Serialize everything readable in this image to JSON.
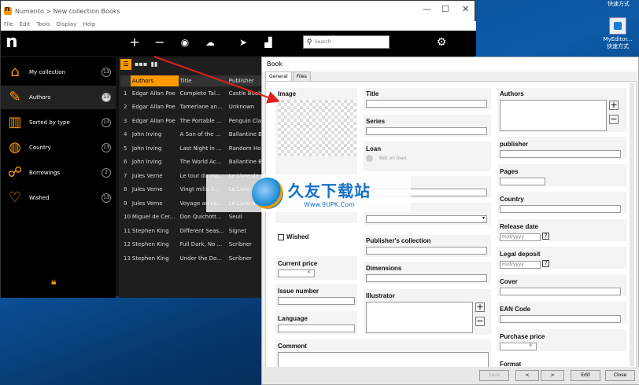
{
  "window": {
    "title": "Numento > New collection Books",
    "controls": [
      "—",
      "☐",
      "✕"
    ]
  },
  "menu": [
    "File",
    "Edit",
    "Tools",
    "Display",
    "Help"
  ],
  "desktop": {
    "top_label": "快速方式",
    "icon_label_1": "MyEditor...",
    "icon_label_2": "快速方式"
  },
  "toolbar": {
    "search_placeholder": "Search"
  },
  "sidebar": {
    "items": [
      {
        "label": "My collection",
        "count": "13"
      },
      {
        "label": "Authors",
        "count": "13"
      },
      {
        "label": "Sorted by type",
        "count": "13"
      },
      {
        "label": "Country",
        "count": "13"
      },
      {
        "label": "Borrowings",
        "count": "2"
      },
      {
        "label": "Wished",
        "count": "13"
      }
    ]
  },
  "grid": {
    "headers": [
      "Authors",
      "Title",
      "Publisher"
    ],
    "rows": [
      {
        "n": "1",
        "author": "Edgar Allan Poe",
        "title": "Complete Tal...",
        "publisher": "Castle Books"
      },
      {
        "n": "2",
        "author": "Edgar Allan Poe",
        "title": "Tamerlane an...",
        "publisher": "Unknown"
      },
      {
        "n": "3",
        "author": "Edgar Allan Poe",
        "title": "The Portable ...",
        "publisher": "Penguin Class"
      },
      {
        "n": "4",
        "author": "John Irving",
        "title": "A Son of the ...",
        "publisher": "Ballantine Bo"
      },
      {
        "n": "5",
        "author": "John Irving",
        "title": "Last Night in ...",
        "publisher": "Random Hous"
      },
      {
        "n": "6",
        "author": "John Irving",
        "title": "The World Ac...",
        "publisher": "Ballantine Bo"
      },
      {
        "n": "7",
        "author": "Jules Verne",
        "title": "Le tour du mo...",
        "publisher": "Le Livre de"
      },
      {
        "n": "8",
        "author": "Jules Verne",
        "title": "Vingt mille li...",
        "publisher": "Le Livre de"
      },
      {
        "n": "9",
        "author": "Jules Verne",
        "title": "Voyage au ce...",
        "publisher": "Le Livre de"
      },
      {
        "n": "10",
        "author": "Miguel de Cer...",
        "title": "Don Quichott...",
        "publisher": "Seuil"
      },
      {
        "n": "11",
        "author": "Stephen King",
        "title": "Different Seas...",
        "publisher": "Signet"
      },
      {
        "n": "12",
        "author": "Stephen King",
        "title": "Full Dark, No ...",
        "publisher": "Scribner"
      },
      {
        "n": "13",
        "author": "Stephen King",
        "title": "Under the Do...",
        "publisher": "Scribner"
      }
    ]
  },
  "watermark": {
    "main": "久友下载站",
    "url": "Www.9UPK.Com"
  },
  "dialog": {
    "title": "Book",
    "tabs": [
      "General",
      "Files"
    ],
    "image_label": "Image",
    "wished_label": "Wished",
    "current_price_label": "Current price",
    "currency": "€",
    "issue_number_label": "Issue number",
    "language_label": "Language",
    "comment_label": "Comment",
    "title_label": "Title",
    "series_label": "Series",
    "loan_label": "Loan",
    "loan_text": "Not on loan",
    "publishers_collection_label": "Publisher's collection",
    "dimensions_label": "Dimensions",
    "illustrator_label": "Illustrator",
    "authors_label": "Authors",
    "publisher_label": "publisher",
    "pages_label": "Pages",
    "country_label": "Country",
    "release_date_label": "Release date",
    "date_placeholder": "m/d/yyyy",
    "legal_deposit_label": "Legal deposit",
    "cover_label": "Cover",
    "ean_label": "EAN Code",
    "purchase_price_label": "Purchase price",
    "format_label": "Format",
    "buttons": {
      "save": "Save",
      "prev": "<",
      "next": ">",
      "edit": "Edit",
      "close": "Close"
    }
  },
  "colors": {
    "accent": "#ff9900",
    "arrow": "#e0201c"
  }
}
